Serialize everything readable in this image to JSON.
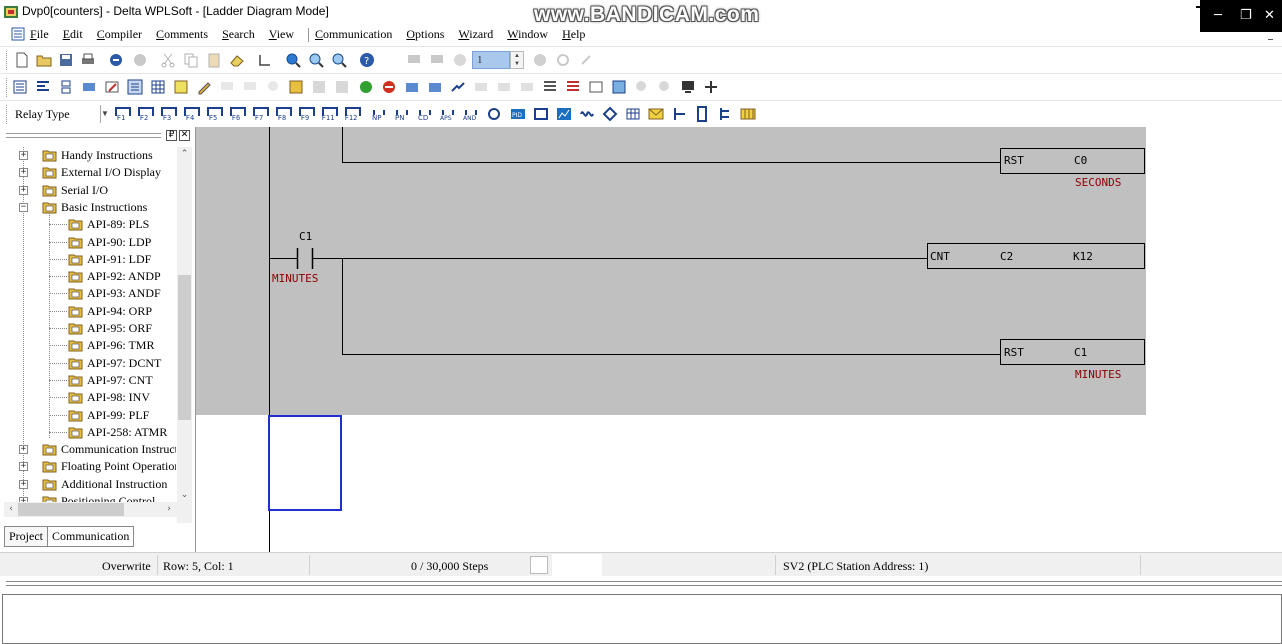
{
  "window": {
    "title": "Dvp0[counters] - Delta WPLSoft - [Ladder Diagram Mode]",
    "watermark": "www.BANDICAM.com",
    "minimize": "─",
    "restore": "❐",
    "close": "✕"
  },
  "menu": {
    "items": [
      "File",
      "Edit",
      "Compiler",
      "Comments",
      "Search",
      "View",
      "Communication",
      "Options",
      "Wizard",
      "Window",
      "Help"
    ]
  },
  "toolbar": {
    "spin_value": "1",
    "relay_type_label": "Relay Type",
    "fkeys": [
      "F1",
      "F2",
      "F3",
      "F4",
      "F5",
      "F6",
      "F7",
      "F8",
      "F9",
      "F11",
      "F12"
    ]
  },
  "panel": {
    "pin": "₽",
    "close": "✕",
    "tree": [
      {
        "label": "Handy Instructions",
        "level": 0,
        "expander": "+"
      },
      {
        "label": "External I/O Display",
        "level": 0,
        "expander": "+"
      },
      {
        "label": "Serial I/O",
        "level": 0,
        "expander": "+"
      },
      {
        "label": "Basic Instructions",
        "level": 0,
        "expander": "−"
      },
      {
        "label": "API-89: PLS",
        "level": 1
      },
      {
        "label": "API-90: LDP",
        "level": 1
      },
      {
        "label": "API-91: LDF",
        "level": 1
      },
      {
        "label": "API-92: ANDP",
        "level": 1
      },
      {
        "label": "API-93: ANDF",
        "level": 1
      },
      {
        "label": "API-94: ORP",
        "level": 1
      },
      {
        "label": "API-95: ORF",
        "level": 1
      },
      {
        "label": "API-96: TMR",
        "level": 1
      },
      {
        "label": "API-97: DCNT",
        "level": 1
      },
      {
        "label": "API-97: CNT",
        "level": 1
      },
      {
        "label": "API-98: INV",
        "level": 1
      },
      {
        "label": "API-99: PLF",
        "level": 1
      },
      {
        "label": "API-258: ATMR",
        "level": 1
      },
      {
        "label": "Communication Instructi",
        "level": 0,
        "expander": "+"
      },
      {
        "label": "Floating Point Operation",
        "level": 0,
        "expander": "+"
      },
      {
        "label": "Additional Instruction",
        "level": 0,
        "expander": "+"
      },
      {
        "label": "Positioning Control",
        "level": 0,
        "expander": "+"
      }
    ],
    "tabs": [
      "Project",
      "Communication"
    ]
  },
  "ladder": {
    "rung1": {
      "instr": "RST",
      "operand": "C0",
      "comment": "SECONDS"
    },
    "rung2": {
      "contact": "C1",
      "contact_comment": "MINUTES",
      "instr": "CNT",
      "operand": "C2",
      "preset": "K12"
    },
    "rung3": {
      "instr": "RST",
      "operand": "C1",
      "comment": "MINUTES"
    },
    "colors": {
      "gray_area": "#c0c0c0",
      "comment": "#8b0000",
      "cursor": "#1f2fd0"
    }
  },
  "status": {
    "mode": "Overwrite",
    "position": "Row: 5, Col: 1",
    "steps": "0 / 30,000 Steps",
    "station": "SV2 (PLC Station Address: 1)"
  }
}
